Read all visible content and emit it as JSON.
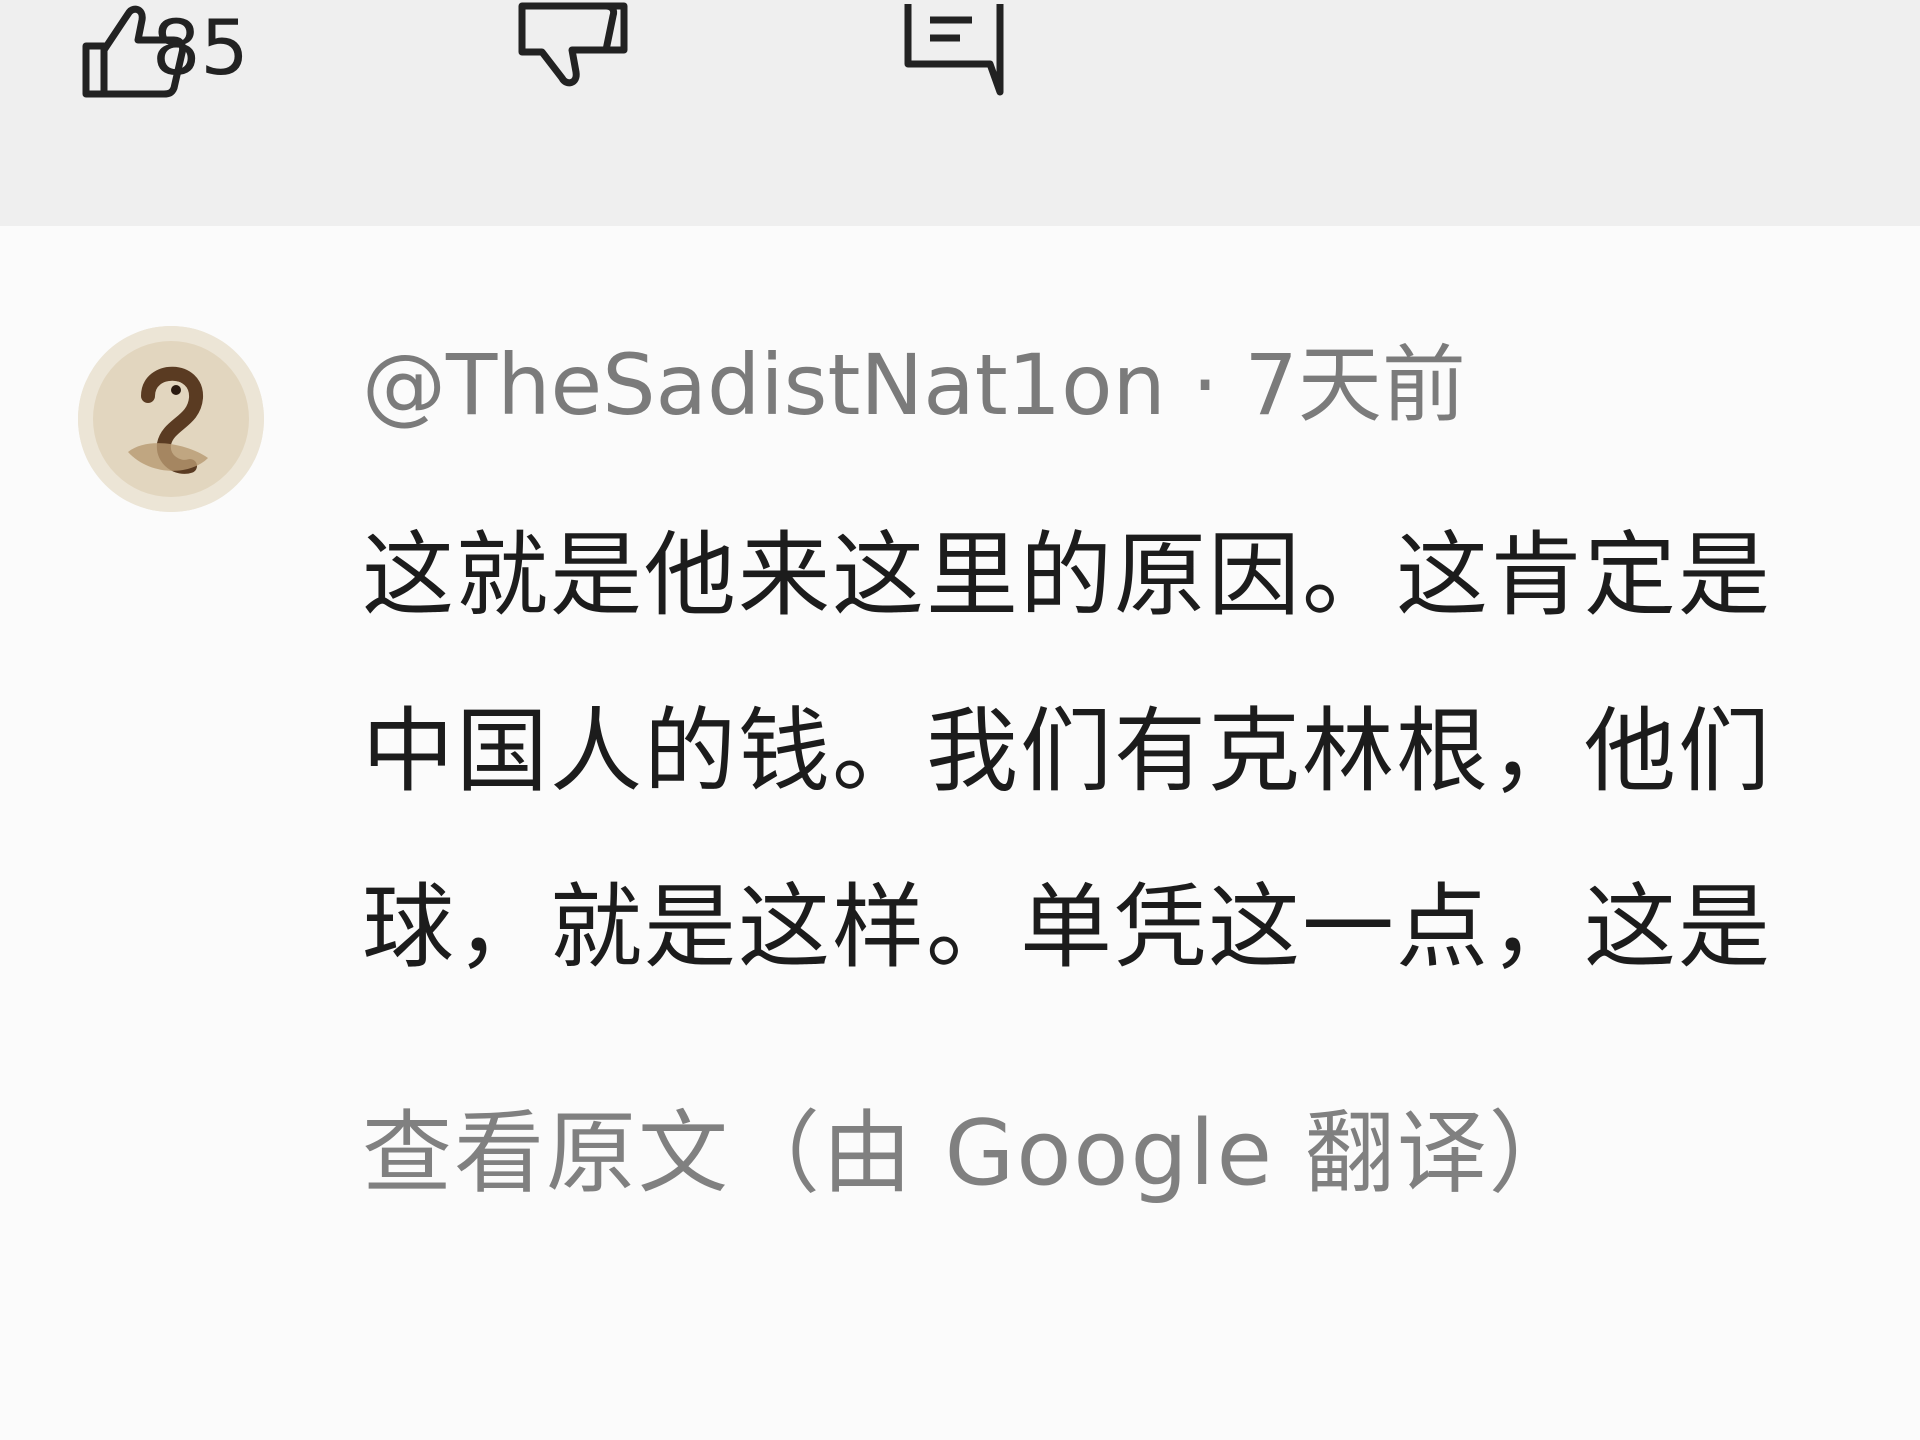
{
  "actions": {
    "like_count": "85",
    "icons": [
      "thumbs-up-icon",
      "thumbs-down-icon",
      "reply-icon"
    ]
  },
  "comment": {
    "author": "@TheSadistNat1on",
    "separator": "·",
    "time": "7天前",
    "lines": [
      "这就是他来这里的原因。这肯定是",
      "中国人的钱。我们有克林根，他们",
      "球，就是这样。单凭这一点，这是"
    ],
    "translate_link": "查看原文（由 Google 翻译）"
  },
  "colors": {
    "action_bar_bg": "#efefef",
    "page_bg": "#fbfbfb",
    "meta_text": "#7b7b7b",
    "body_text": "#1c1c1c",
    "link_text": "#808080"
  }
}
